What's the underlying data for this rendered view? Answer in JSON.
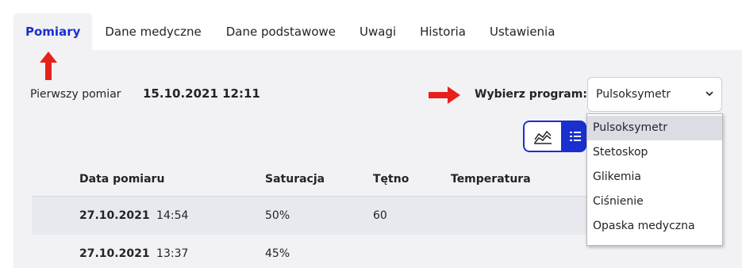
{
  "tabs": [
    {
      "label": "Pomiary",
      "active": true
    },
    {
      "label": "Dane medyczne",
      "active": false
    },
    {
      "label": "Dane podstawowe",
      "active": false
    },
    {
      "label": "Uwagi",
      "active": false
    },
    {
      "label": "Historia",
      "active": false
    },
    {
      "label": "Ustawienia",
      "active": false
    }
  ],
  "first_measurement": {
    "label": "Pierwszy pomiar",
    "value": "15.10.2021 12:11"
  },
  "program": {
    "label": "Wybierz program:",
    "selected": "Pulsoksymetr",
    "options": [
      "Pulsoksymetr",
      "Stetoskop",
      "Glikemia",
      "Ciśnienie",
      "Opaska medyczna"
    ]
  },
  "view_toggle": {
    "chart_icon": "chart-icon",
    "list_icon": "list-icon",
    "active": "list"
  },
  "table": {
    "headers": [
      "Data pomiaru",
      "Saturacja",
      "Tętno",
      "Temperatura"
    ],
    "rows": [
      {
        "date": "27.10.2021",
        "time": "14:54",
        "saturation": "50%",
        "pulse": "60",
        "temperature": ""
      },
      {
        "date": "27.10.2021",
        "time": "13:37",
        "saturation": "45%",
        "pulse": "",
        "temperature": ""
      }
    ]
  },
  "annotations": {
    "arrow_color": "#e8201b",
    "arrow_up": "arrow-up-icon",
    "arrow_right": "arrow-right-icon"
  },
  "colors": {
    "accent": "#1a2fd0",
    "panel_bg": "#f2f2f5"
  }
}
